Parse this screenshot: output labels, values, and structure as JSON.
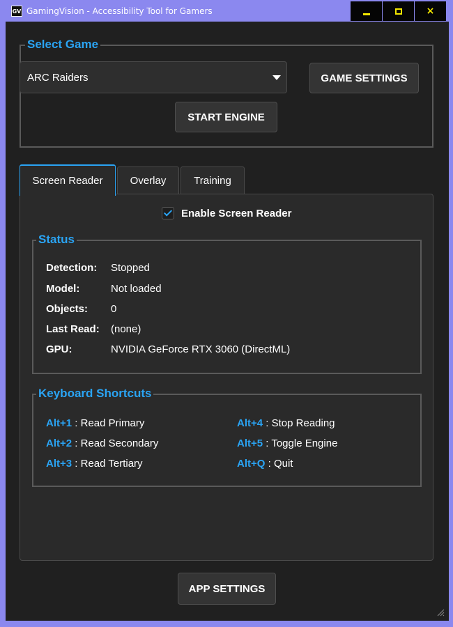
{
  "window": {
    "icon_text": "GV",
    "title": "GamingVision - Accessibility Tool for Gamers",
    "controls": {
      "minimize": "minimize",
      "maximize": "maximize",
      "close": "×"
    }
  },
  "select_game": {
    "title": "Select Game",
    "selected": "ARC Raiders",
    "game_settings_label": "GAME SETTINGS",
    "start_engine_label": "START ENGINE"
  },
  "tabs": [
    {
      "label": "Screen Reader",
      "active": true
    },
    {
      "label": "Overlay",
      "active": false
    },
    {
      "label": "Training",
      "active": false
    }
  ],
  "screen_reader": {
    "enable_label": "Enable Screen Reader",
    "enabled": true,
    "status": {
      "title": "Status",
      "rows": [
        {
          "key": "Detection:",
          "value": "Stopped"
        },
        {
          "key": "Model:",
          "value": "Not loaded"
        },
        {
          "key": "Objects:",
          "value": "0"
        },
        {
          "key": "Last Read:",
          "value": "(none)"
        },
        {
          "key": "GPU:",
          "value": "NVIDIA GeForce RTX 3060 (DirectML)"
        }
      ]
    },
    "shortcuts": {
      "title": "Keyboard Shortcuts",
      "items": [
        {
          "key": "Alt+1",
          "sep": " : ",
          "action": "Read Primary"
        },
        {
          "key": "Alt+2",
          "sep": " : ",
          "action": "Read Secondary"
        },
        {
          "key": "Alt+3",
          "sep": " : ",
          "action": "Read Tertiary"
        },
        {
          "key": "Alt+4",
          "sep": " : ",
          "action": "Stop Reading"
        },
        {
          "key": "Alt+5",
          "sep": " : ",
          "action": "Toggle Engine"
        },
        {
          "key": "Alt+Q",
          "sep": " : ",
          "action": "Quit"
        }
      ]
    }
  },
  "footer": {
    "app_settings_label": "APP SETTINGS"
  },
  "colors": {
    "accent": "#2aa4f4",
    "background": "#202020",
    "panel": "#2a2a2a",
    "window_border": "#8b88ef",
    "control_glyph": "#f2e600"
  }
}
